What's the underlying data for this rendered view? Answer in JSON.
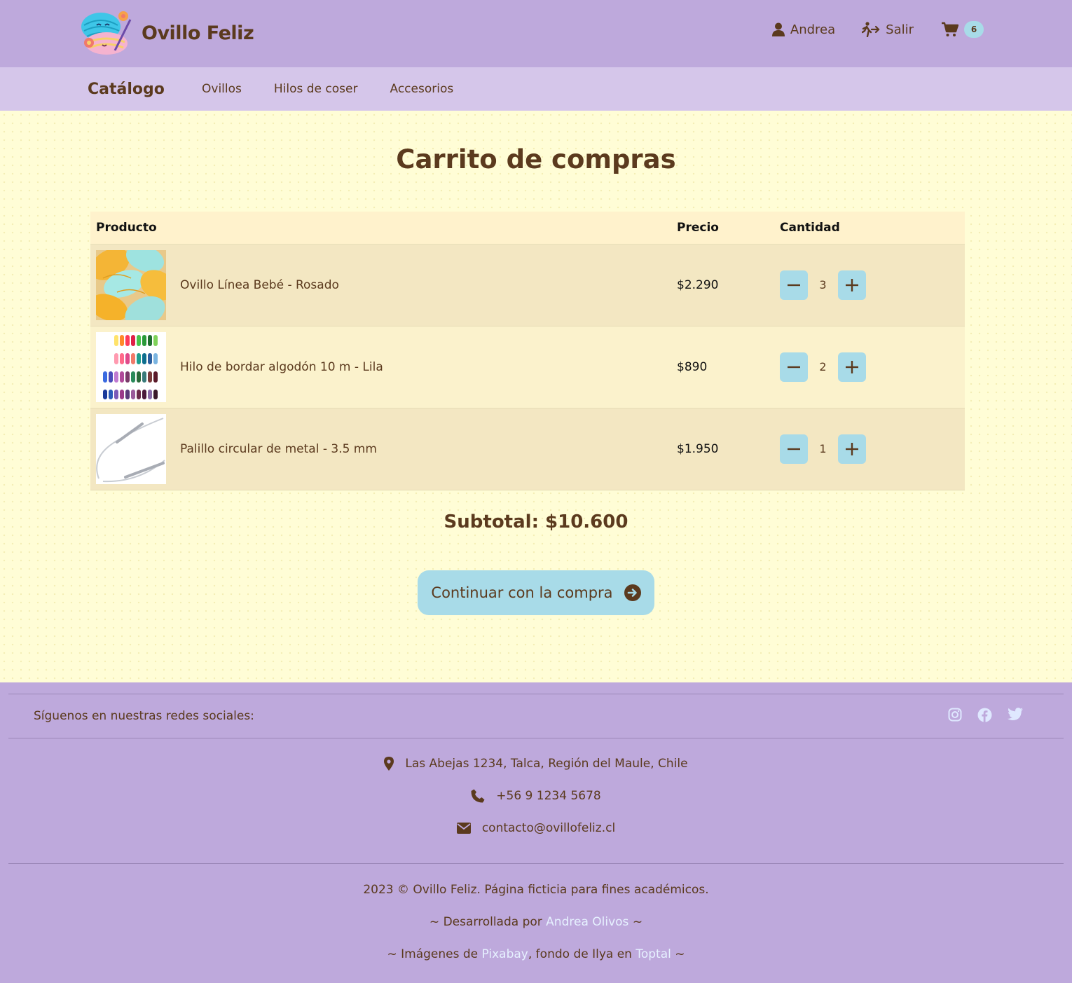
{
  "header": {
    "brand_name": "Ovillo Feliz",
    "user_label": "Andrea",
    "logout_label": "Salir",
    "cart_count": "6"
  },
  "nav": {
    "title": "Catálogo",
    "items": [
      "Ovillos",
      "Hilos de coser",
      "Accesorios"
    ]
  },
  "main": {
    "title": "Carrito de compras",
    "table": {
      "headers": {
        "product": "Producto",
        "price": "Precio",
        "quantity": "Cantidad"
      },
      "rows": [
        {
          "name": "Ovillo Línea Bebé - Rosado",
          "price": "$2.290",
          "qty": "3"
        },
        {
          "name": "Hilo de bordar algodón 10 m - Lila",
          "price": "$890",
          "qty": "2"
        },
        {
          "name": "Palillo circular de metal - 3.5 mm",
          "price": "$1.950",
          "qty": "1"
        }
      ]
    },
    "subtotal": "Subtotal: $10.600",
    "continue_label": "Continuar con la compra"
  },
  "footer": {
    "social_text": "Síguenos en nuestras redes sociales:",
    "address": "Las Abejas 1234, Talca, Región del Maule, Chile",
    "phone": "+56 9 1234 5678",
    "email": "contacto@ovillofeliz.cl",
    "copyright": "2023 © Ovillo Feliz. Página ficticia para fines académicos.",
    "dev_prefix": "~ Desarrollada por ",
    "dev_name": "Andrea Olivos",
    "dev_suffix": " ~",
    "img_prefix": "~ Imágenes de ",
    "img_source": "Pixabay",
    "img_middle": ", fondo de Ilya en ",
    "bg_source": "Toptal",
    "img_suffix": " ~"
  },
  "colors": {
    "header_bg": "#bea9dc",
    "nav_bg": "#d5c6ea",
    "page_bg": "#fffdd6",
    "accent": "#a8dbe8",
    "text": "#5b3a1e"
  }
}
